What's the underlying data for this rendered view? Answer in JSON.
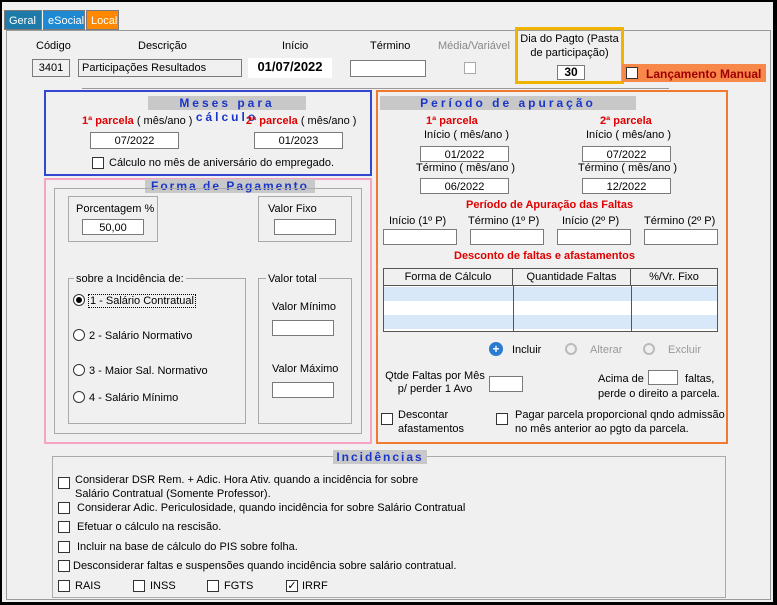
{
  "tabs": [
    {
      "label": "Geral",
      "bg": "#1e7aa8"
    },
    {
      "label": "eSocial",
      "bg": "#1e88d2"
    },
    {
      "label": "Local",
      "bg": "#ff8800"
    }
  ],
  "header": {
    "codigo_label": "Código",
    "codigo_value": "3401",
    "descricao_label": "Descrição",
    "descricao_value": "Participações Resultados",
    "inicio_label": "Início",
    "inicio_value": "01/07/2022",
    "termino_label": "Término",
    "termino_value": "",
    "media_label": "Média/Variável",
    "dia_pagto_label": "Dia do Pagto (Pasta de participação)",
    "dia_pagto_value": "30",
    "lancamento_label": "Lançamento Manual"
  },
  "meses": {
    "title": "Meses para cálculo",
    "p1_label": "1ª parcela",
    "p1_suffix": " ( mês/ano )",
    "p1_value": "07/2022",
    "p2_label": "2ª parcela",
    "p2_suffix": " ( mês/ano )",
    "p2_value": "01/2023",
    "aniversario_label": "Cálculo no mês de aniversário do empregado."
  },
  "forma": {
    "title": "Forma de Pagamento",
    "porcentagem_label": "Porcentagem %",
    "porcentagem_value": "50,00",
    "valor_fixo_label": "Valor Fixo",
    "valor_fixo_value": "",
    "incidencia_label": "sobre a Incidência de:",
    "options": [
      "1 - Salário Contratual",
      "2 - Salário Normativo",
      "3 - Maior Sal. Normativo",
      "4 - Salário Mínimo"
    ],
    "valor_total_label": "Valor total",
    "valor_minimo_label": "Valor Mínimo",
    "valor_maximo_label": "Valor Máximo"
  },
  "periodo": {
    "title": "Período de apuração",
    "p1_label": "1ª parcela",
    "p2_label": "2ª parcela",
    "inicio_label": "Início ( mês/ano )",
    "termino_label": "Término ( mês/ano )",
    "p1_inicio": "01/2022",
    "p1_termino": "06/2022",
    "p2_inicio": "07/2022",
    "p2_termino": "12/2022",
    "faltas_title": "Período de Apuração das Faltas",
    "faltas_cols": [
      "Início (1º P)",
      "Término (1º P)",
      "Início (2º P)",
      "Término (2º P)"
    ],
    "desconto_title": "Desconto de faltas e afastamentos",
    "grid_cols": [
      "Forma de Cálculo",
      "Quantidade Faltas",
      "%/Vr. Fixo"
    ],
    "btn_incluir": "Incluir",
    "btn_alterar": "Alterar",
    "btn_excluir": "Excluir",
    "qtde_label": "Qtde Faltas por Mês p/ perder 1 Avo",
    "acima_label": "Acima de",
    "faltas_label": "faltas,",
    "perde_label": "perde o direito a parcela.",
    "descontar_label": "Descontar afastamentos",
    "pagar_label": "Pagar parcela proporcional qndo admissão no mês anterior ao pgto da parcela."
  },
  "incidencias": {
    "title": "Incidências",
    "items": [
      "Considerar DSR Rem. + Adic. Hora Ativ. quando a incidência for sobre Salário Contratual (Somente Professor).",
      "Considerar Adic. Periculosidade, quando incidência for sobre Salário Contratual",
      "Efetuar o cálculo na rescisão.",
      "Incluir na base de cálculo do PIS sobre folha.",
      "Desconsiderar faltas e suspensões quando incidência sobre salário contratual."
    ],
    "taxes": [
      {
        "label": "RAIS",
        "checked": false
      },
      {
        "label": "INSS",
        "checked": false
      },
      {
        "label": "FGTS",
        "checked": false
      },
      {
        "label": "IRRF",
        "checked": true
      }
    ]
  }
}
